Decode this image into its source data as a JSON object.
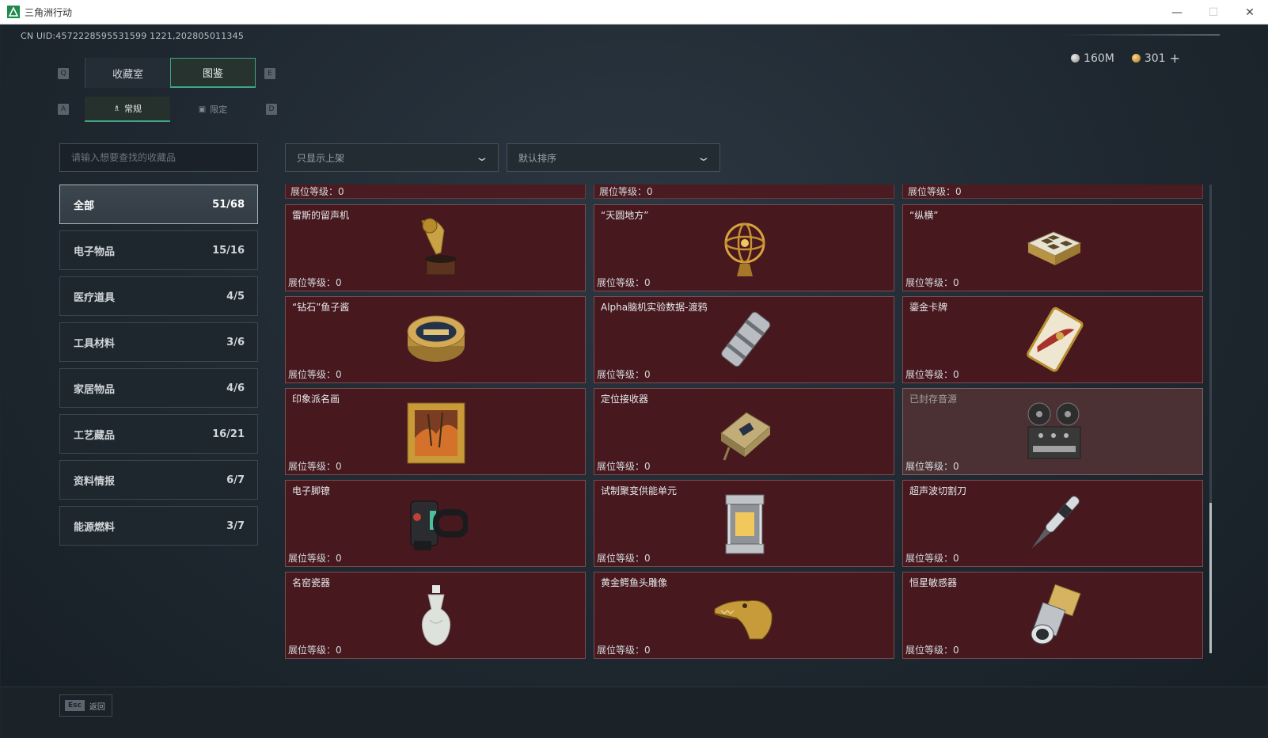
{
  "window": {
    "title": "三角洲行动",
    "minimize": "—",
    "maximize": "☐",
    "close": "✕"
  },
  "header": {
    "uid": "CN UID:4572228595531599 1221,202805011345",
    "currency": [
      {
        "icon": "silver-coin-icon",
        "value": "160M"
      },
      {
        "icon": "gold-coin-icon",
        "value": "301"
      }
    ],
    "add_label": "+"
  },
  "keys": {
    "tab_left": "Q",
    "tab_right": "E",
    "sub_left": "A",
    "sub_right": "D"
  },
  "tabs": [
    {
      "label": "收藏室",
      "active": false
    },
    {
      "label": "图鉴",
      "active": true
    }
  ],
  "subtabs": [
    {
      "label": "常规",
      "icon": "figure-icon",
      "active": true
    },
    {
      "label": "限定",
      "icon": "image-icon",
      "active": false
    }
  ],
  "search": {
    "placeholder": "请输入想要查找的收藏品",
    "value": ""
  },
  "filters": [
    {
      "label": "只显示上架"
    },
    {
      "label": "默认排序"
    }
  ],
  "categories": [
    {
      "label": "全部",
      "count": "51/68",
      "active": true
    },
    {
      "label": "电子物品",
      "count": "15/16",
      "active": false
    },
    {
      "label": "医疗道具",
      "count": "4/5",
      "active": false
    },
    {
      "label": "工具材料",
      "count": "3/6",
      "active": false
    },
    {
      "label": "家居物品",
      "count": "4/6",
      "active": false
    },
    {
      "label": "工艺藏品",
      "count": "16/21",
      "active": false
    },
    {
      "label": "资料情报",
      "count": "6/7",
      "active": false
    },
    {
      "label": "能源燃料",
      "count": "3/7",
      "active": false
    }
  ],
  "level_label": "展位等级：",
  "partial_row": [
    "0",
    "0",
    "0"
  ],
  "items": [
    {
      "name": "雷斯的留声机",
      "level": "0",
      "icon": "gramophone-icon",
      "sealed": false
    },
    {
      "name": "“天圆地方”",
      "level": "0",
      "icon": "armillary-sphere-icon",
      "sealed": false
    },
    {
      "name": "“纵横”",
      "level": "0",
      "icon": "chess-box-icon",
      "sealed": false
    },
    {
      "name": "“钻石”鱼子酱",
      "level": "0",
      "icon": "caviar-tin-icon",
      "sealed": false
    },
    {
      "name": "Alpha脑机实验数据-渡鸦",
      "level": "0",
      "icon": "data-cylinder-icon",
      "sealed": false
    },
    {
      "name": "鎏金卡牌",
      "level": "0",
      "icon": "gilded-card-icon",
      "sealed": false
    },
    {
      "name": "印象派名画",
      "level": "0",
      "icon": "painting-icon",
      "sealed": false
    },
    {
      "name": "定位接收器",
      "level": "0",
      "icon": "receiver-icon",
      "sealed": false
    },
    {
      "name": "已封存音源",
      "level": "0",
      "icon": "reel-recorder-icon",
      "sealed": true
    },
    {
      "name": "电子脚镣",
      "level": "0",
      "icon": "ankle-monitor-icon",
      "sealed": false
    },
    {
      "name": "试制聚变供能单元",
      "level": "0",
      "icon": "fusion-cell-icon",
      "sealed": false
    },
    {
      "name": "超声波切割刀",
      "level": "0",
      "icon": "ultrasonic-knife-icon",
      "sealed": false
    },
    {
      "name": "名窑瓷器",
      "level": "0",
      "icon": "porcelain-vase-icon",
      "sealed": false
    },
    {
      "name": "黄金鳄鱼头雕像",
      "level": "0",
      "icon": "gold-crocodile-icon",
      "sealed": false
    },
    {
      "name": "恒星敏感器",
      "level": "0",
      "icon": "star-sensor-icon",
      "sealed": false
    }
  ],
  "footer": {
    "esc_key": "Esc",
    "back_label": "返回"
  }
}
